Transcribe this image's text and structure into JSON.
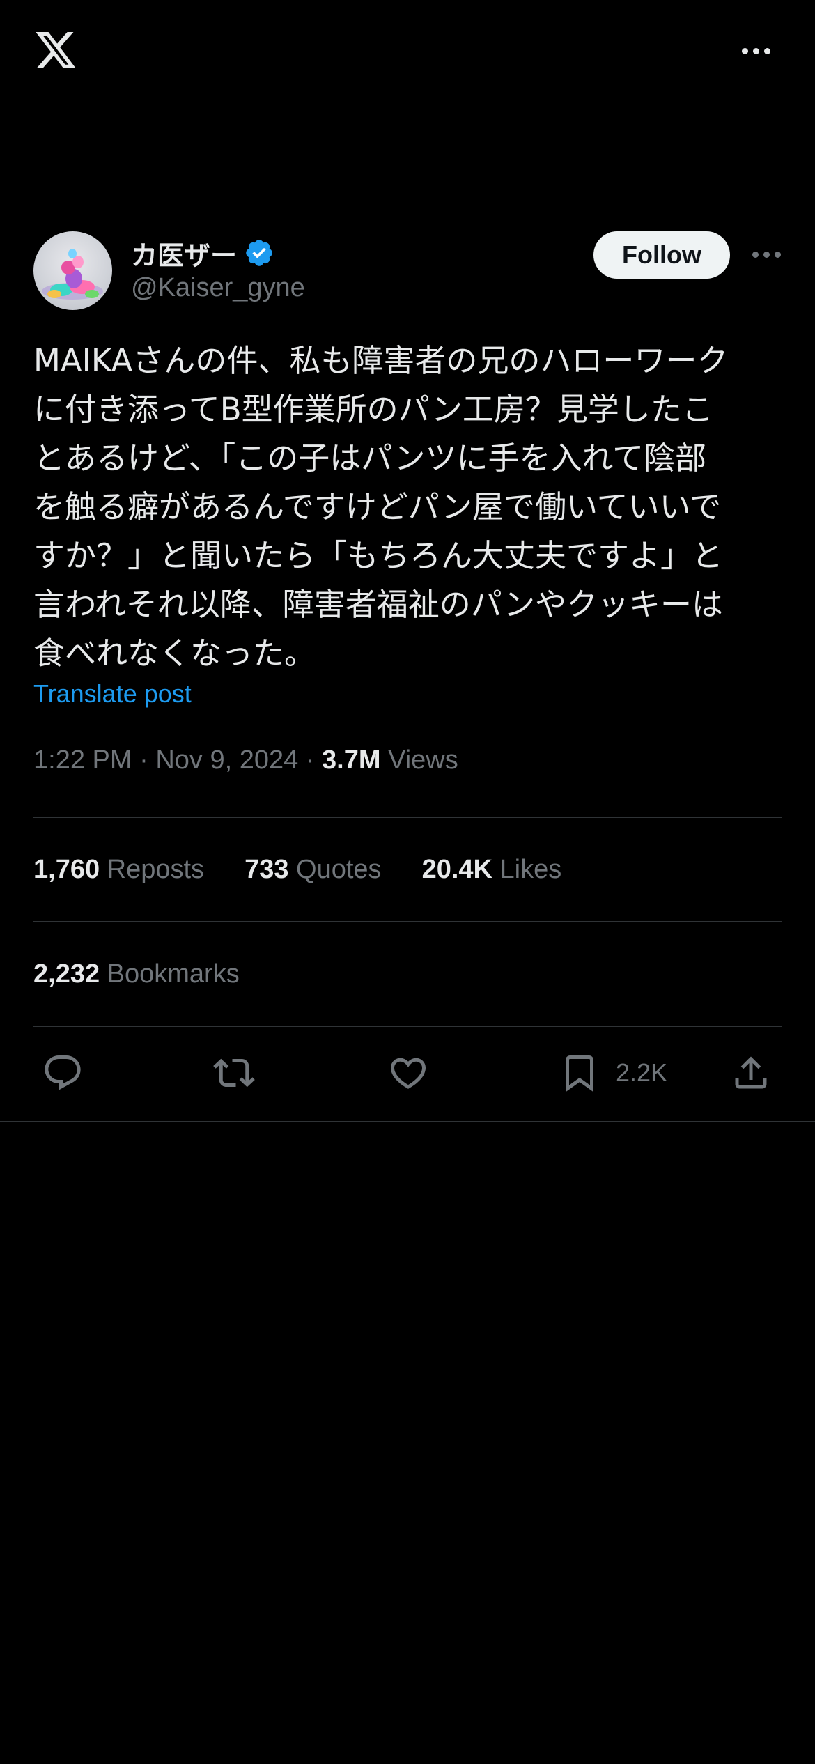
{
  "topbar": {
    "logo_icon": "x-logo-icon",
    "more_icon": "more-horizontal-icon"
  },
  "author": {
    "display_name": "カ医ザー",
    "handle": "@Kaiser_gyne",
    "verified_icon": "verified-badge-icon",
    "verified_color": "#1d9bf0",
    "follow_label": "Follow"
  },
  "tweet": {
    "text": "MAIKAさんの件、私も障害者の兄のハローワーク\nに付き添ってB型作業所のパン工房？見学したこ\nとあるけど、「この子はパンツに手を入れて陰部\nを触る癖があるんですけどパン屋で働いていいで\nすか？」と聞いたら「もちろん大丈夫ですよ」と\n言われそれ以降、障害者福祉のパンやクッキーは\n食べれなくなった。",
    "translate_label": "Translate post",
    "time": "1:22 PM",
    "separator": "·",
    "date": "Nov 9, 2024",
    "views_count": "3.7M",
    "views_label": "Views"
  },
  "stats": {
    "reposts_count": "1,760",
    "reposts_label": "Reposts",
    "quotes_count": "733",
    "quotes_label": "Quotes",
    "likes_count": "20.4K",
    "likes_label": "Likes",
    "bookmarks_count": "2,232",
    "bookmarks_label": "Bookmarks"
  },
  "actions": {
    "reply_icon": "reply-icon",
    "repost_icon": "repost-icon",
    "like_icon": "heart-icon",
    "bookmark_icon": "bookmark-icon",
    "bookmark_count": "2.2K",
    "share_icon": "share-icon"
  },
  "colors": {
    "background": "#000000",
    "text_primary": "#e7e9ea",
    "text_secondary": "#71767b",
    "link": "#1d9bf0",
    "divider": "#2f3336",
    "follow_bg": "#eff3f4"
  }
}
